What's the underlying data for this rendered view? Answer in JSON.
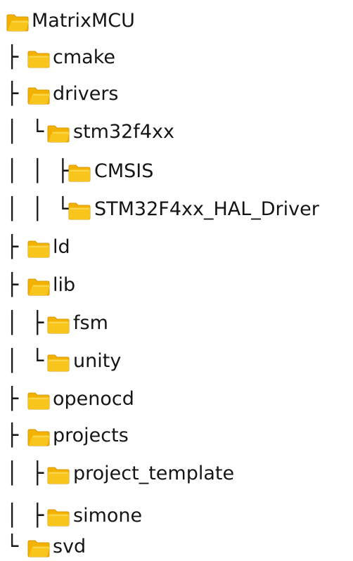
{
  "tree": {
    "items": [
      {
        "label": "MatrixMCU",
        "prefix": "",
        "folder": "open-folder-icon"
      },
      {
        "label": "cmake",
        "prefix": "├",
        "folder": "closed-folder-icon"
      },
      {
        "label": "drivers",
        "prefix": "├",
        "folder": "open-folder-icon"
      },
      {
        "label": "stm32f4xx",
        "prefix": "│ └",
        "folder": "open-folder-icon"
      },
      {
        "label": "CMSIS",
        "prefix": "│ │ ├",
        "folder": "closed-folder-icon"
      },
      {
        "label": "STM32F4xx_HAL_Driver",
        "prefix": "│ │ └",
        "folder": "closed-folder-icon"
      },
      {
        "label": "ld",
        "prefix": "├",
        "folder": "closed-folder-icon"
      },
      {
        "label": "lib",
        "prefix": "├",
        "folder": "open-folder-icon"
      },
      {
        "label": "fsm",
        "prefix": "│ ├",
        "folder": "closed-folder-icon"
      },
      {
        "label": "unity",
        "prefix": "│ └",
        "folder": "closed-folder-icon"
      },
      {
        "label": "openocd",
        "prefix": "├",
        "folder": "closed-folder-icon"
      },
      {
        "label": "projects",
        "prefix": "├",
        "folder": "open-folder-icon"
      },
      {
        "label": "project_template",
        "prefix": "│ ├",
        "folder": "closed-folder-icon"
      },
      {
        "label": "simone",
        "prefix": "│ ├",
        "folder": "closed-folder-icon"
      },
      {
        "label": "svd",
        "prefix": "└",
        "folder": "open-folder-icon"
      }
    ]
  },
  "colors": {
    "folder_body": "#f7c51b",
    "folder_back": "#f4b200",
    "folder_edge": "#d9980b"
  }
}
